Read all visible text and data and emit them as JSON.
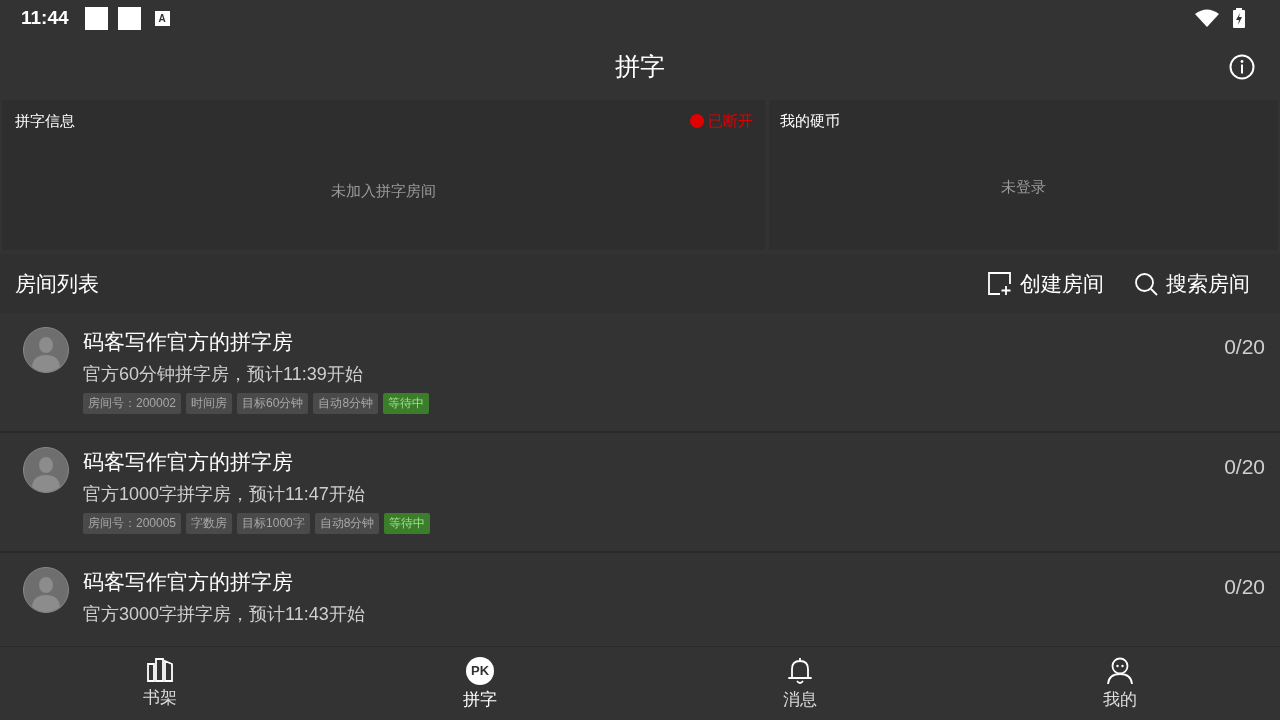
{
  "status_bar": {
    "time": "11:44",
    "notification_glyph": "A"
  },
  "header": {
    "title": "拼字"
  },
  "info_panel": {
    "title": "拼字信息",
    "connection": {
      "label": "已断开",
      "connected": false
    },
    "message": "未加入拼字房间"
  },
  "coins_panel": {
    "title": "我的硬币",
    "message": "未登录"
  },
  "room_list": {
    "title": "房间列表",
    "actions": [
      {
        "kind": "create",
        "label": "创建房间"
      },
      {
        "kind": "search",
        "label": "搜索房间"
      }
    ],
    "rooms": [
      {
        "name": "码客写作官方的拼字房",
        "description": "官方60分钟拼字房，预计11:39开始",
        "count": "0/20",
        "tags": [
          {
            "kind": "info",
            "label": "房间号：200002"
          },
          {
            "kind": "info",
            "label": "时间房"
          },
          {
            "kind": "info",
            "label": "目标60分钟"
          },
          {
            "kind": "info",
            "label": "自动8分钟"
          },
          {
            "kind": "status",
            "label": "等待中"
          }
        ]
      },
      {
        "name": "码客写作官方的拼字房",
        "description": "官方1000字拼字房，预计11:47开始",
        "count": "0/20",
        "tags": [
          {
            "kind": "info",
            "label": "房间号：200005"
          },
          {
            "kind": "info",
            "label": "字数房"
          },
          {
            "kind": "info",
            "label": "目标1000字"
          },
          {
            "kind": "info",
            "label": "自动8分钟"
          },
          {
            "kind": "status",
            "label": "等待中"
          }
        ]
      },
      {
        "name": "码客写作官方的拼字房",
        "description": "官方3000字拼字房，预计11:43开始",
        "count": "0/20"
      }
    ]
  },
  "bottom_nav": [
    {
      "kind": "shelf",
      "label": "书架",
      "selected": false
    },
    {
      "kind": "pk",
      "label": "拼字",
      "icon_text": "PK",
      "selected": true
    },
    {
      "kind": "bell",
      "label": "消息",
      "selected": false
    },
    {
      "kind": "person",
      "label": "我的",
      "selected": false
    }
  ]
}
